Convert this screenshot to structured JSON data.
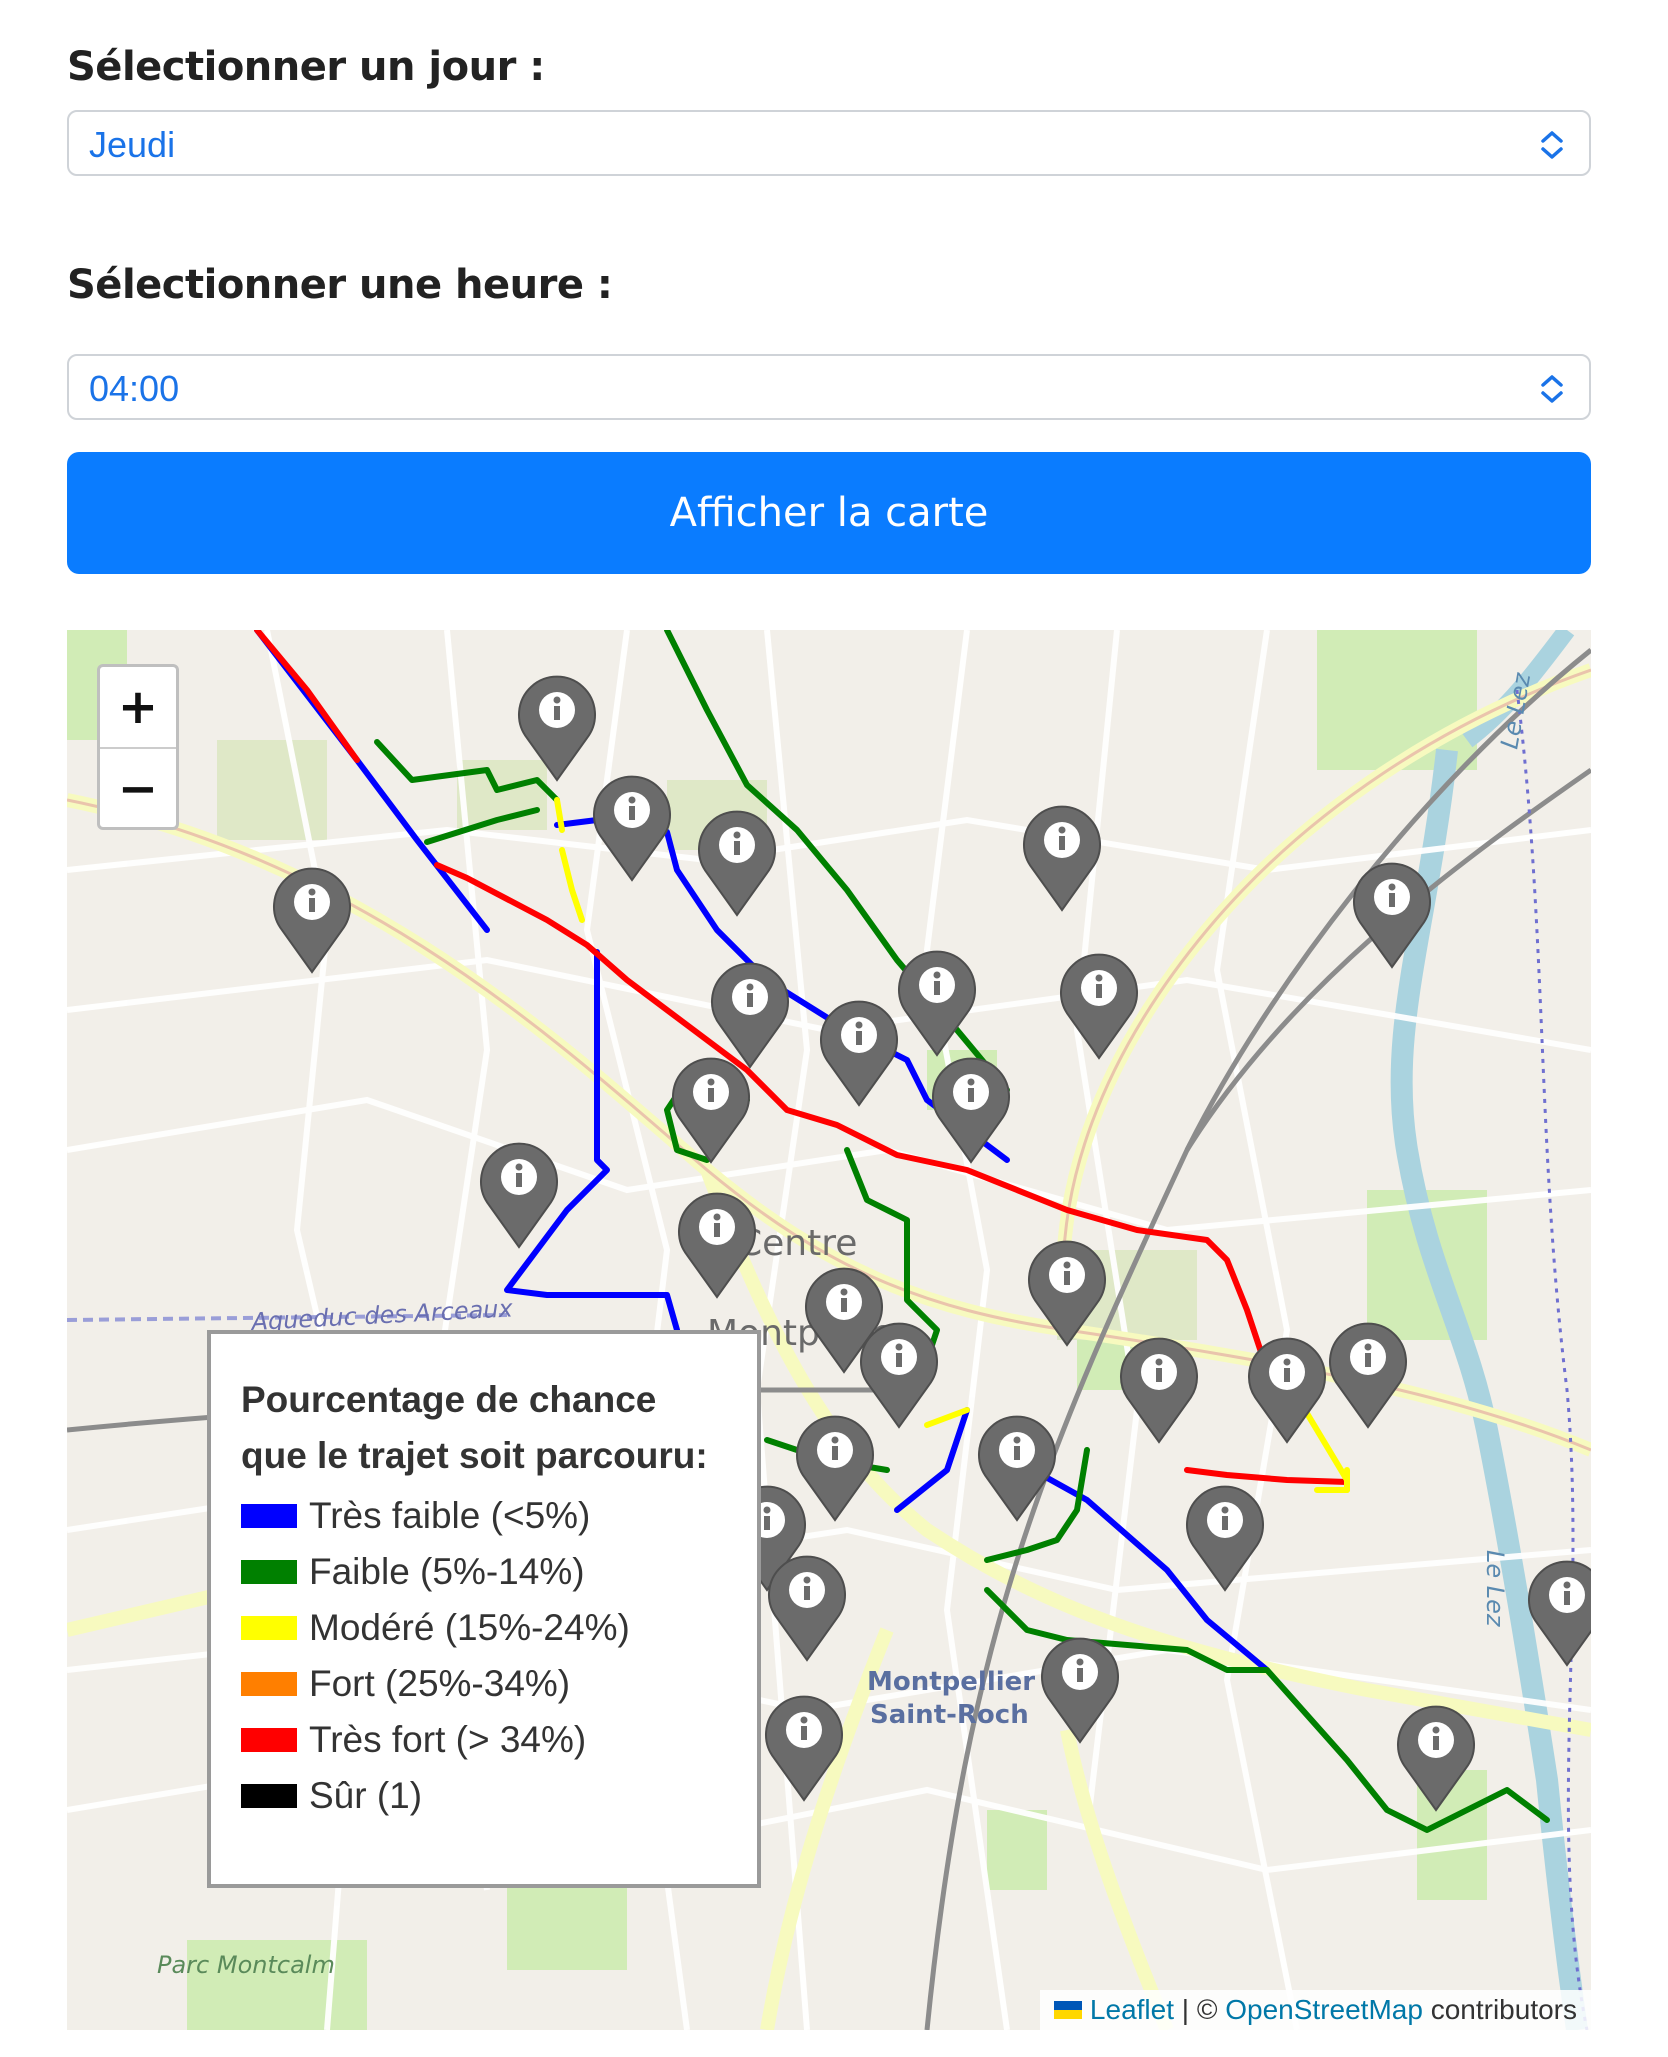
{
  "form": {
    "day_label": "Sélectionner un jour :",
    "day_value": "Jeudi",
    "hour_label": "Sélectionner une heure :",
    "hour_value": "04:00",
    "submit_label": "Afficher la carte"
  },
  "map": {
    "zoom_in": "+",
    "zoom_out": "−",
    "place_labels": [
      "Centre",
      "Montpellier",
      "Montpellier",
      "Saint-Roch",
      "Parc Montcalm",
      "Aqueduc des Arceaux",
      "Le Lez",
      "Le Lez"
    ],
    "marker_icon": "info-marker-icon",
    "marker_count": 29,
    "route_colors": {
      "blue": "#0000ff",
      "green": "#008000",
      "yellow": "#ffff00",
      "red": "#ff0000"
    },
    "legend": {
      "title": "Pourcentage de chance que le trajet soit parcouru:",
      "items": [
        {
          "label": "Très faible (<5%)",
          "color": "#0000ff"
        },
        {
          "label": "Faible (5%-14%)",
          "color": "#008000"
        },
        {
          "label": "Modéré (15%-24%)",
          "color": "#ffff00"
        },
        {
          "label": "Fort (25%-34%)",
          "color": "#ff7f00"
        },
        {
          "label": "Très fort (> 34%)",
          "color": "#ff0000"
        },
        {
          "label": "Sûr (1)",
          "color": "#000000"
        }
      ]
    },
    "attribution": {
      "leaflet": "Leaflet",
      "separator": " | © ",
      "osm": "OpenStreetMap",
      "suffix": " contributors"
    }
  }
}
